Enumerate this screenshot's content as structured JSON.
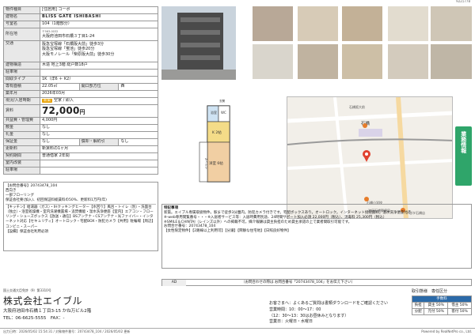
{
  "top_id": "9221778",
  "spec": {
    "type_label": "物件種目",
    "type_value": "[住居用] コーポ",
    "name_label": "建物名",
    "name_value": "BLISS GATE ISHIBASHI",
    "room_label": "号室名",
    "room_value": "104（1階部分）",
    "address_label": "所在地",
    "address_zip": "〒563-0032",
    "address_value": "大阪府池田市石橋３丁目1-24",
    "traffic_label": "交通",
    "traffic_lines": [
      "阪急宝塚線「石橋阪大前」徒歩3分",
      "阪急宝塚線「蛍池」徒歩20分",
      "大阪モノレール「柴原阪大前」徒歩30分"
    ],
    "structure_label": "建物構造",
    "structure_value": "木造 地上3階 総戸数18戸",
    "parking_label": "駐車場",
    "layout_label": "間取タイプ",
    "layout_value": "1K（洋6 ＋ K2）",
    "area_label": "専有面積",
    "area_value": "22.05㎡",
    "dir_label": "開口部方位",
    "dir_value": "西",
    "built_label": "築年月",
    "built_value": "2026年03月",
    "status_label": "現況/入居時期",
    "status_badge": "新築",
    "status_value": "空家 / 即入",
    "rent_label": "賃料",
    "rent_value": "72,000",
    "rent_unit": "円",
    "mgmt_label": "共益費・管理費",
    "mgmt_value": "4,000円",
    "deposit_label": "敷金",
    "deposit_value": "なし",
    "key_label": "礼金",
    "key_value": "なし",
    "guarantee_label": "保証金",
    "guarantee_value": "なし",
    "amort_label": "償却・解約引",
    "amort_value": "なし",
    "renew_label": "更新料",
    "renew_value": "新賃料の1ヶ月",
    "contract_label": "契約期間",
    "contract_value": "普通借家 2年間",
    "misc_label": "室内改装",
    "parking2_label": "駐車場"
  },
  "remarks": {
    "lines": [
      "【お問合番号】20743478_104",
      "西向き",
      "一部フローリング",
      "保証会社要(加入)、初回保証料総賃料の50%、更新料1万円(年)",
      "【キッチン】給湯器（ガス）・IHクッキングヒーター【水回り】風呂・トイレ（別）・洗面台（独立）・浴室乾燥機・室内洗濯機置場・追焚機能・温水洗浄便座【室内】エアコン・フローリング・シューズボックス【放送・通信】BSアンテナ・CSアンテナ・光ファイバー・インターネット対応【セキュリティ】オートロック・宅配BOX・防犯カメラ【共用】駐輪場【周辺】コンビニ・スーパー",
      "【設備】保証会社利用必須"
    ]
  },
  "notes": {
    "header": "特記事項",
    "lines": [
      "新築。エイブル専属取扱物件。駅まで徒歩3分圏内。防犯カメラ付きです。宅配ボックスあり。オートロック。インターネット接続無料。温水洗浄便座付き。",
      "※-web専用閲覧番号・・・※入居者サービス等：入居時費用別途、24時間サポート加入必須 22,000円（税込）、消毒料 25,300円（税込）",
      "※SMILE＆CHINTAI（レインズ以外）への掲載不可。媒介報酬は貸主負担のため貸主承諾の上で業者間取引可能です。",
      "お問合せ番号：20743478_104",
      "【女性限定物件】【2路線以上利用可】【分譲】【閑静な住宅地】【日照良好物件】"
    ]
  },
  "adbar": {
    "ad_label": "AD",
    "inquiry_text": "（お問合わせの際は お問合番号「20743478_104」をお伝え下さい）"
  },
  "map": {
    "station_label": "石橋",
    "label_1": "石橋阪大前",
    "label_2": "石橋小学校",
    "label_3": "池田石橋郵便局",
    "label_4": "アピタ石橋店",
    "side_label": "業務情報"
  },
  "plan": {
    "room_label": "洋室 6帖",
    "kitchen_label": "K 2帖",
    "bath_label": "浴室",
    "balcony_label": "ベランダ",
    "wc_label": "WC",
    "entrance_label": "玄関"
  },
  "footer": {
    "license": "国土交通大臣免許（9）第3310号",
    "company": "株式会社エイブル",
    "address": "大阪府池田市石橋１丁目3-15 かね万ビル2階",
    "tel": "TEL：06-6625-5555　FAX：-",
    "contact_lines": [
      "お客さまへ：よくあるご質問は書類ダウンロードをご確認ください",
      "営業時間：10：00〜17：00",
      "（12：30〜13：30はお昼休みとなります）",
      "営業日：火曜日・水曜日"
    ],
    "fee_title": "取引態様　専任区分",
    "fee_header": "手数料",
    "fee_rows": [
      [
        "負担",
        "貸主 50%",
        "借主 50%"
      ],
      [
        "分配",
        "元付 50%",
        "客付 50%"
      ]
    ],
    "bottom_left": "出力日時：2026/05/02 15:54:31 / 対象物件番号：20743478_104 / 2026/05/02 更新",
    "bottom_right": "Powered by RealNetPro co., Ltd."
  }
}
